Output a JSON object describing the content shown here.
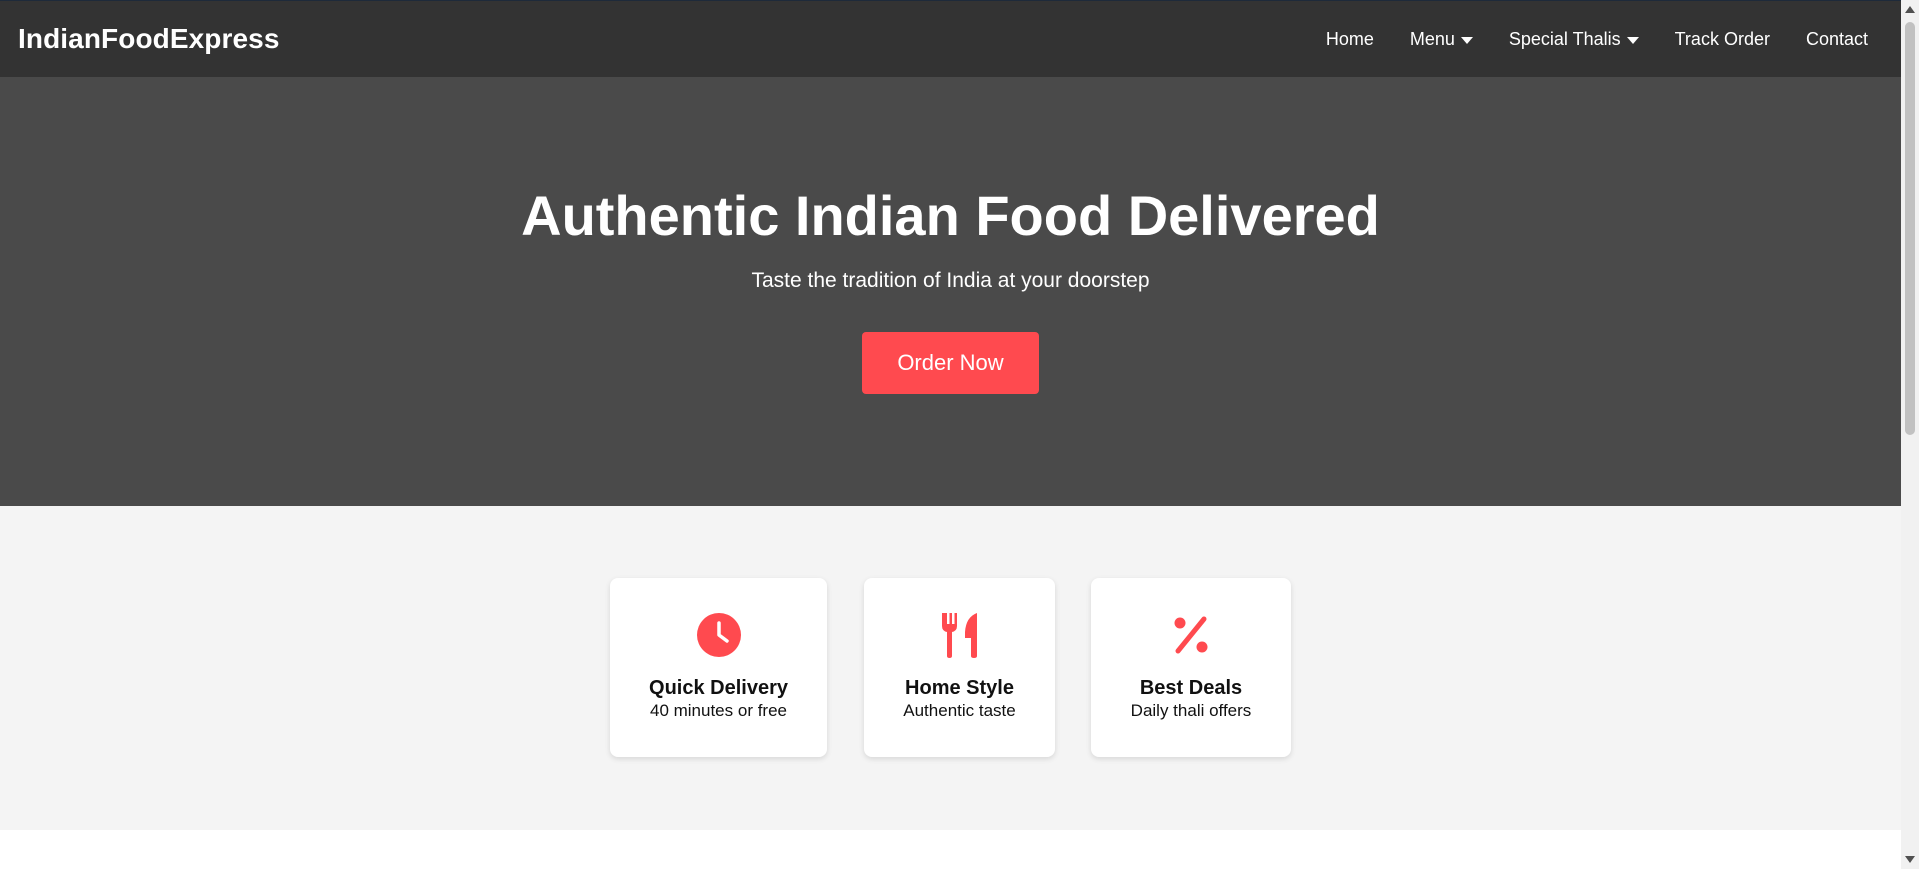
{
  "header": {
    "brand": "IndianFoodExpress",
    "nav": {
      "home": "Home",
      "menu": "Menu",
      "special_thalis": "Special Thalis",
      "track_order": "Track Order",
      "contact": "Contact"
    }
  },
  "hero": {
    "title": "Authentic Indian Food Delivered",
    "subtitle": "Taste the tradition of India at your doorstep",
    "cta_label": "Order Now"
  },
  "features": [
    {
      "icon": "clock-icon",
      "title": "Quick Delivery",
      "text": "40 minutes or free"
    },
    {
      "icon": "utensils-icon",
      "title": "Home Style",
      "text": "Authentic taste"
    },
    {
      "icon": "percent-icon",
      "title": "Best Deals",
      "text": "Daily thali offers"
    }
  ],
  "colors": {
    "navbar_bg": "#333333",
    "hero_bg": "#4a4a4a",
    "accent": "#ff4a4f",
    "features_bg": "#f4f4f4"
  }
}
